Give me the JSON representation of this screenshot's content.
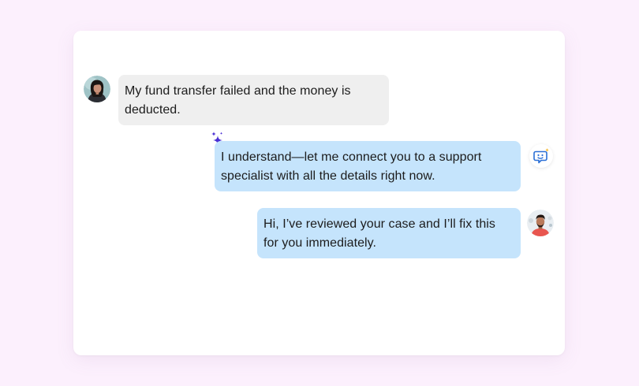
{
  "chat": {
    "messages": [
      {
        "sender": "customer",
        "text": "My fund transfer failed and the money is deducted."
      },
      {
        "sender": "ai-assistant",
        "text": "I understand—let me connect you to a support specialist with all the details right now."
      },
      {
        "sender": "support-agent",
        "text": "Hi, I’ve reviewed your case and I’ll fix this for you immediately."
      }
    ]
  },
  "icons": {
    "customer_avatar": "woman-avatar",
    "sparkle": "sparkle-icon",
    "bot": "chatbot-icon",
    "agent_avatar": "man-avatar"
  },
  "colors": {
    "page_background": "#fcf0fd",
    "card_background": "#ffffff",
    "customer_bubble": "#efefef",
    "reply_bubble": "#c5e4fc",
    "sparkle": "#4a2fd4",
    "bot_icon_blue": "#2a6fd6",
    "bot_icon_star": "#f5b82e"
  }
}
